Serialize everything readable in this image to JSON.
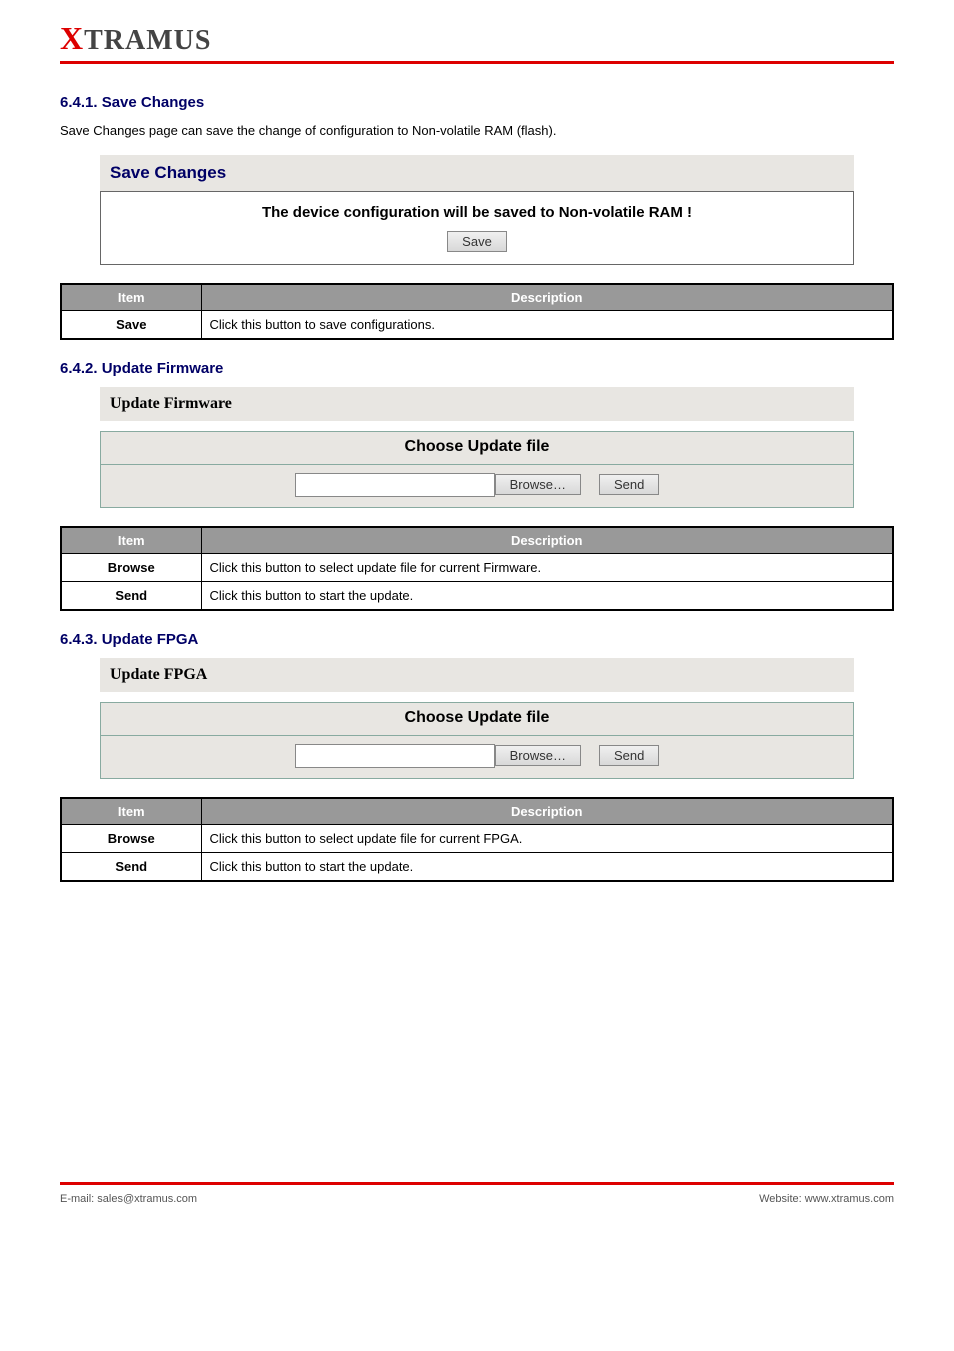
{
  "logo": {
    "x": "X",
    "rest": "TRAMUS"
  },
  "sec_save": {
    "number": "6.4.1. Save Changes",
    "intro": "Save Changes page can save the change of configuration to Non-volatile RAM (flash).",
    "panel_title": "Save Changes",
    "msg": "The device configuration will be saved to Non-volatile RAM !",
    "save_btn": "Save",
    "tbl_hdr_item": "Item",
    "tbl_hdr_desc": "Description",
    "row_key": "Save",
    "row_val": "Click this button to save configurations."
  },
  "sec_fw": {
    "number": "6.4.2. Update Firmware",
    "panel_title": "Update Firmware",
    "box_title": "Choose Update file",
    "browse_btn": "Browse…",
    "send_btn": "Send",
    "tbl_hdr_item": "Item",
    "tbl_hdr_desc": "Description",
    "rows": [
      {
        "k": "Browse",
        "v": "Click this button to select update file for current Firmware."
      },
      {
        "k": "Send",
        "v": "Click this button to start the update."
      }
    ]
  },
  "sec_fpga": {
    "number": "6.4.3. Update FPGA",
    "panel_title": "Update FPGA",
    "box_title": "Choose Update file",
    "browse_btn": "Browse…",
    "send_btn": "Send",
    "tbl_hdr_item": "Item",
    "tbl_hdr_desc": "Description",
    "rows": [
      {
        "k": "Browse",
        "v": "Click this button to select update file for current FPGA."
      },
      {
        "k": "Send",
        "v": "Click this button to start the update."
      }
    ]
  },
  "footer": {
    "left": "E-mail: sales@xtramus.com",
    "right": "Website: www.xtramus.com"
  }
}
